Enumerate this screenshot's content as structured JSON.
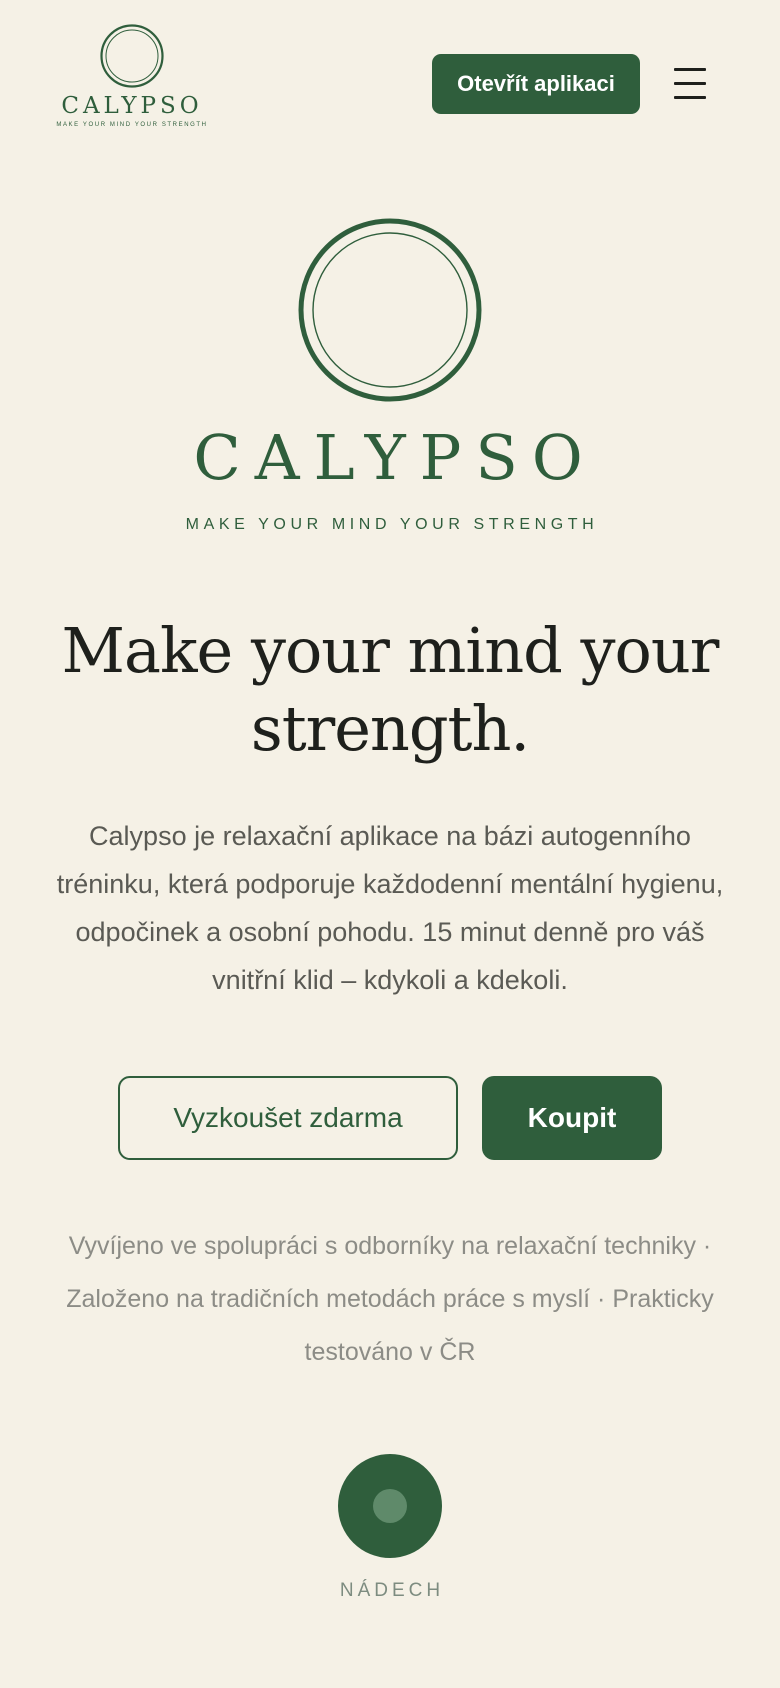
{
  "header": {
    "logo_name": "CALYPSO",
    "logo_tagline": "MAKE YOUR MIND YOUR STRENGTH",
    "open_app_label": "Otevřít aplikaci",
    "menu_icon": "hamburger-menu-icon"
  },
  "hero": {
    "brand_name": "CALYPSO",
    "brand_tagline": "MAKE YOUR MIND YOUR STRENGTH",
    "headline_line1": "Make your mind your",
    "headline_line2": "strength.",
    "description": "Calypso je relaxační aplikace na bázi autogenního tréninku, která podporuje každodenní mentální hygienu, odpočinek a osobní pohodu. 15 minut denně pro váš vnitřní klid – kdykoli a kdekoli.",
    "try_free_label": "Vyzkoušet zdarma",
    "buy_label": "Koupit",
    "trust_note": "Vyvíjeno ve spolupráci s odborníky na relaxační techniky · Založeno na tradičních metodách práce s myslí · Prakticky testováno v ČR"
  },
  "breathing": {
    "label": "NÁDECH"
  },
  "colors": {
    "background": "#f5f1e6",
    "brand_green": "#2f5e3c",
    "text_dark": "#1e201c",
    "text_muted": "#5a5a54",
    "text_light": "#8c8c86"
  }
}
